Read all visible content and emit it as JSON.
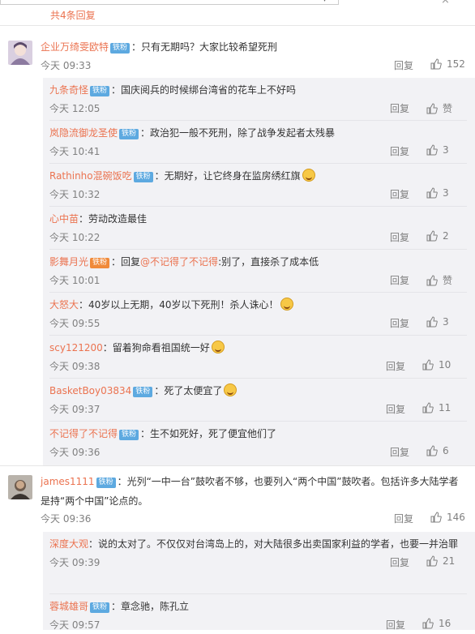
{
  "top": {
    "collapsed_link": "共4条回复"
  },
  "badge_label": "铁粉",
  "reply_label": "回复",
  "comments": [
    {
      "user": "企业万绮雯欧特",
      "text": "：只有无期吗？大家比较希望死刑",
      "time": "今天 09:33",
      "likes": "152",
      "replies": [
        {
          "user": "九条奇怪",
          "badge": true,
          "text": "：国庆阅兵的时候绑台湾省的花车上不好吗",
          "time": "今天 12:05",
          "likes": "赞"
        },
        {
          "user": "岚隐流御龙圣使",
          "badge": true,
          "text": "：政治犯一般不死刑，除了战争发起者太残暴",
          "time": "今天 10:41",
          "likes": "3"
        },
        {
          "user": "Rathinho混碗饭吃",
          "badge": true,
          "text": "：无期好，让它终身在监房绣红旗",
          "time": "今天 10:32",
          "likes": "3",
          "emoji": true
        },
        {
          "user": "心中苗",
          "badge": false,
          "text": "：劳动改造最佳",
          "time": "今天 10:22",
          "likes": "2"
        },
        {
          "user": "影舞月光",
          "badge": true,
          "text_pre": "：回复",
          "mention": "@不记得了不记得",
          "text": ":别了，直接杀了成本低",
          "time": "今天 10:01",
          "likes": "赞"
        },
        {
          "user": "大怒大",
          "badge": false,
          "text": "：40岁以上无期，40岁以下死刑！杀人诛心！",
          "time": "今天 09:55",
          "likes": "3",
          "emoji": true
        },
        {
          "user": "scy121200",
          "badge": false,
          "text": "：留着狗命看祖国统一好",
          "time": "今天 09:38",
          "likes": "10",
          "emoji": true
        },
        {
          "user": "BasketBoy03834",
          "badge": true,
          "text": "：死了太便宜了",
          "time": "今天 09:37",
          "likes": "11",
          "emoji": true
        },
        {
          "user": "不记得了不记得",
          "badge": true,
          "text": "：生不如死好，死了便宜他们了",
          "time": "今天 09:36",
          "likes": "6"
        }
      ]
    },
    {
      "user": "james1111",
      "text": "：光列“一中一台”鼓吹者不够，也要列入“两个中国”鼓吹者。包括许多大陆学者是持“两个中国”论点的。",
      "time": "今天 09:36",
      "likes": "146",
      "replies": [
        {
          "user": "深度大观",
          "badge": false,
          "text": "：说的太对了。不仅仅对台湾岛上的，对大陆很多出卖国家利益的学者，也要一并治罪",
          "time": "今天 09:39",
          "likes": "21"
        },
        {
          "user": "蓉城雄哥",
          "badge": true,
          "text": "：章念驰，陈孔立",
          "time": "今天 09:57",
          "likes": "16"
        }
      ]
    }
  ]
}
